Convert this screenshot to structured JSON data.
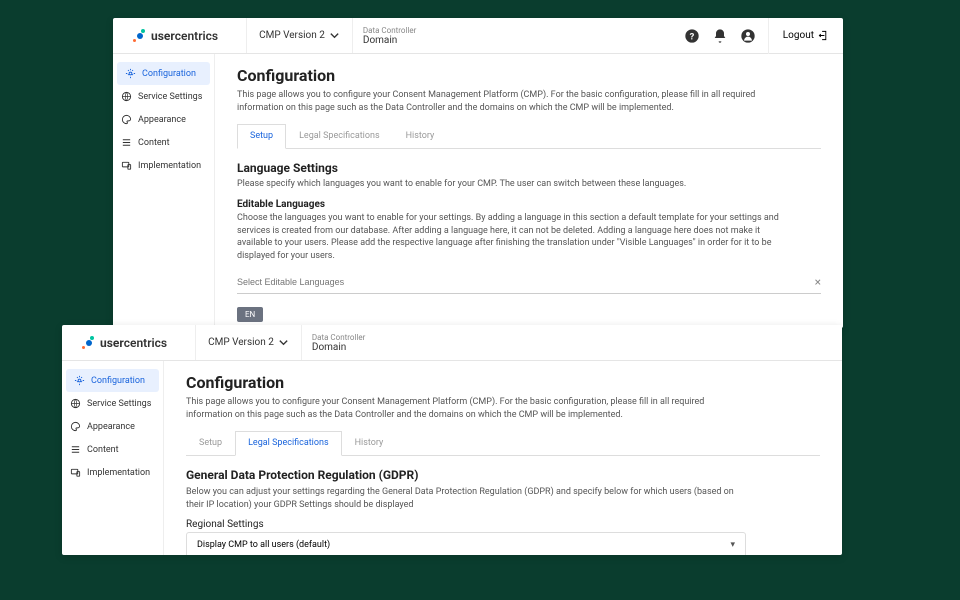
{
  "brand": {
    "name_prefix": "user",
    "name_suffix": "centrics"
  },
  "version_selector": "CMP Version 2",
  "data_controller": {
    "label": "Data Controller",
    "value": "Domain"
  },
  "header_actions": {
    "logout": "Logout"
  },
  "sidebar": {
    "items": [
      {
        "label": "Configuration",
        "icon": "gear"
      },
      {
        "label": "Service Settings",
        "icon": "globe"
      },
      {
        "label": "Appearance",
        "icon": "palette"
      },
      {
        "label": "Content",
        "icon": "list"
      },
      {
        "label": "Implementation",
        "icon": "device"
      }
    ]
  },
  "page": {
    "title": "Configuration",
    "description": "This page allows you to configure your Consent Management Platform (CMP). For the basic configuration, please fill in all required information on this page such as the Data Controller and the domains on which the CMP will be implemented."
  },
  "tabs": [
    {
      "label": "Setup"
    },
    {
      "label": "Legal Specifications"
    },
    {
      "label": "History"
    }
  ],
  "panel_a": {
    "active_tab": 0,
    "language_settings": {
      "title": "Language Settings",
      "description": "Please specify which languages you want to enable for your CMP. The user can switch between these languages.",
      "editable_title": "Editable Languages",
      "editable_description": "Choose the languages you want to enable for your settings. By adding a language in this section a default template for your settings and services is created from our database. After adding a language here, it can not be deleted. Adding a language here does not make it available to your users. Please add the respective language after finishing the translation under \"Visible Languages\" in order for it to be displayed for your users.",
      "placeholder": "Select Editable Languages",
      "chip": "EN"
    }
  },
  "panel_b": {
    "active_tab": 1,
    "gdpr": {
      "title": "General Data Protection Regulation (GDPR)",
      "description": "Below you can adjust your settings regarding the General Data Protection Regulation (GDPR) and specify below for which users (based on their IP location) your GDPR Settings should be displayed",
      "regional_label": "Regional Settings",
      "select_value": "Display CMP to all users (default)"
    }
  }
}
